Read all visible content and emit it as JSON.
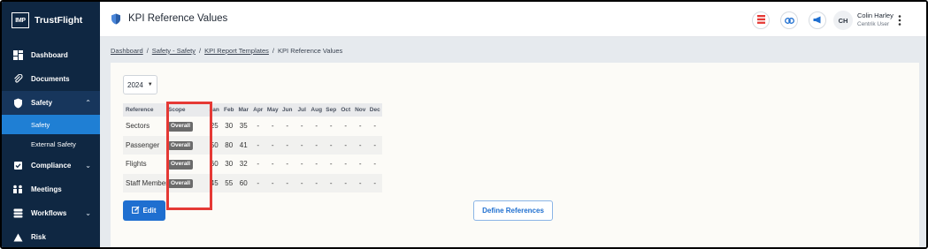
{
  "brand": {
    "logo_text": "IMP",
    "name": "TrustFlight"
  },
  "sidebar": {
    "items": [
      {
        "label": "Dashboard",
        "icon": "dashboard-icon"
      },
      {
        "label": "Documents",
        "icon": "paperclip-icon"
      },
      {
        "label": "Safety",
        "icon": "shield-icon",
        "expanded": true
      },
      {
        "label": "Compliance",
        "icon": "compliance-icon"
      },
      {
        "label": "Meetings",
        "icon": "meetings-icon"
      },
      {
        "label": "Workflows",
        "icon": "workflows-icon"
      },
      {
        "label": "Risk",
        "icon": "warning-icon"
      }
    ],
    "safety_sub": [
      "Safety",
      "External Safety"
    ]
  },
  "header": {
    "title": "KPI Reference Values",
    "user_initials": "CH",
    "user_name": "Colin Harley",
    "user_role": "Centrik User"
  },
  "breadcrumb": [
    "Dashboard",
    "Safety - Safety",
    "KPI Report Templates",
    "KPI Reference Values"
  ],
  "year": "2024",
  "table": {
    "headers": [
      "Reference",
      "Scope",
      "Jan",
      "Feb",
      "Mar",
      "Apr",
      "May",
      "Jun",
      "Jul",
      "Aug",
      "Sep",
      "Oct",
      "Nov",
      "Dec"
    ],
    "rows": [
      {
        "reference": "Sectors",
        "scope": "Overall",
        "months": [
          "25",
          "30",
          "35",
          "-",
          "-",
          "-",
          "-",
          "-",
          "-",
          "-",
          "-",
          "-"
        ]
      },
      {
        "reference": "Passenger",
        "scope": "Overall",
        "months": [
          "50",
          "80",
          "41",
          "-",
          "-",
          "-",
          "-",
          "-",
          "-",
          "-",
          "-",
          "-"
        ]
      },
      {
        "reference": "Flights",
        "scope": "Overall",
        "months": [
          "60",
          "30",
          "32",
          "-",
          "-",
          "-",
          "-",
          "-",
          "-",
          "-",
          "-",
          "-"
        ]
      },
      {
        "reference": "Staff Members",
        "scope": "Overall",
        "months": [
          "45",
          "55",
          "60",
          "-",
          "-",
          "-",
          "-",
          "-",
          "-",
          "-",
          "-",
          "-"
        ]
      }
    ]
  },
  "buttons": {
    "edit": "Edit",
    "define": "Define References"
  },
  "colors": {
    "sidebar": "#0f2742",
    "accent": "#1f6fd0",
    "highlight": "#e53935"
  }
}
